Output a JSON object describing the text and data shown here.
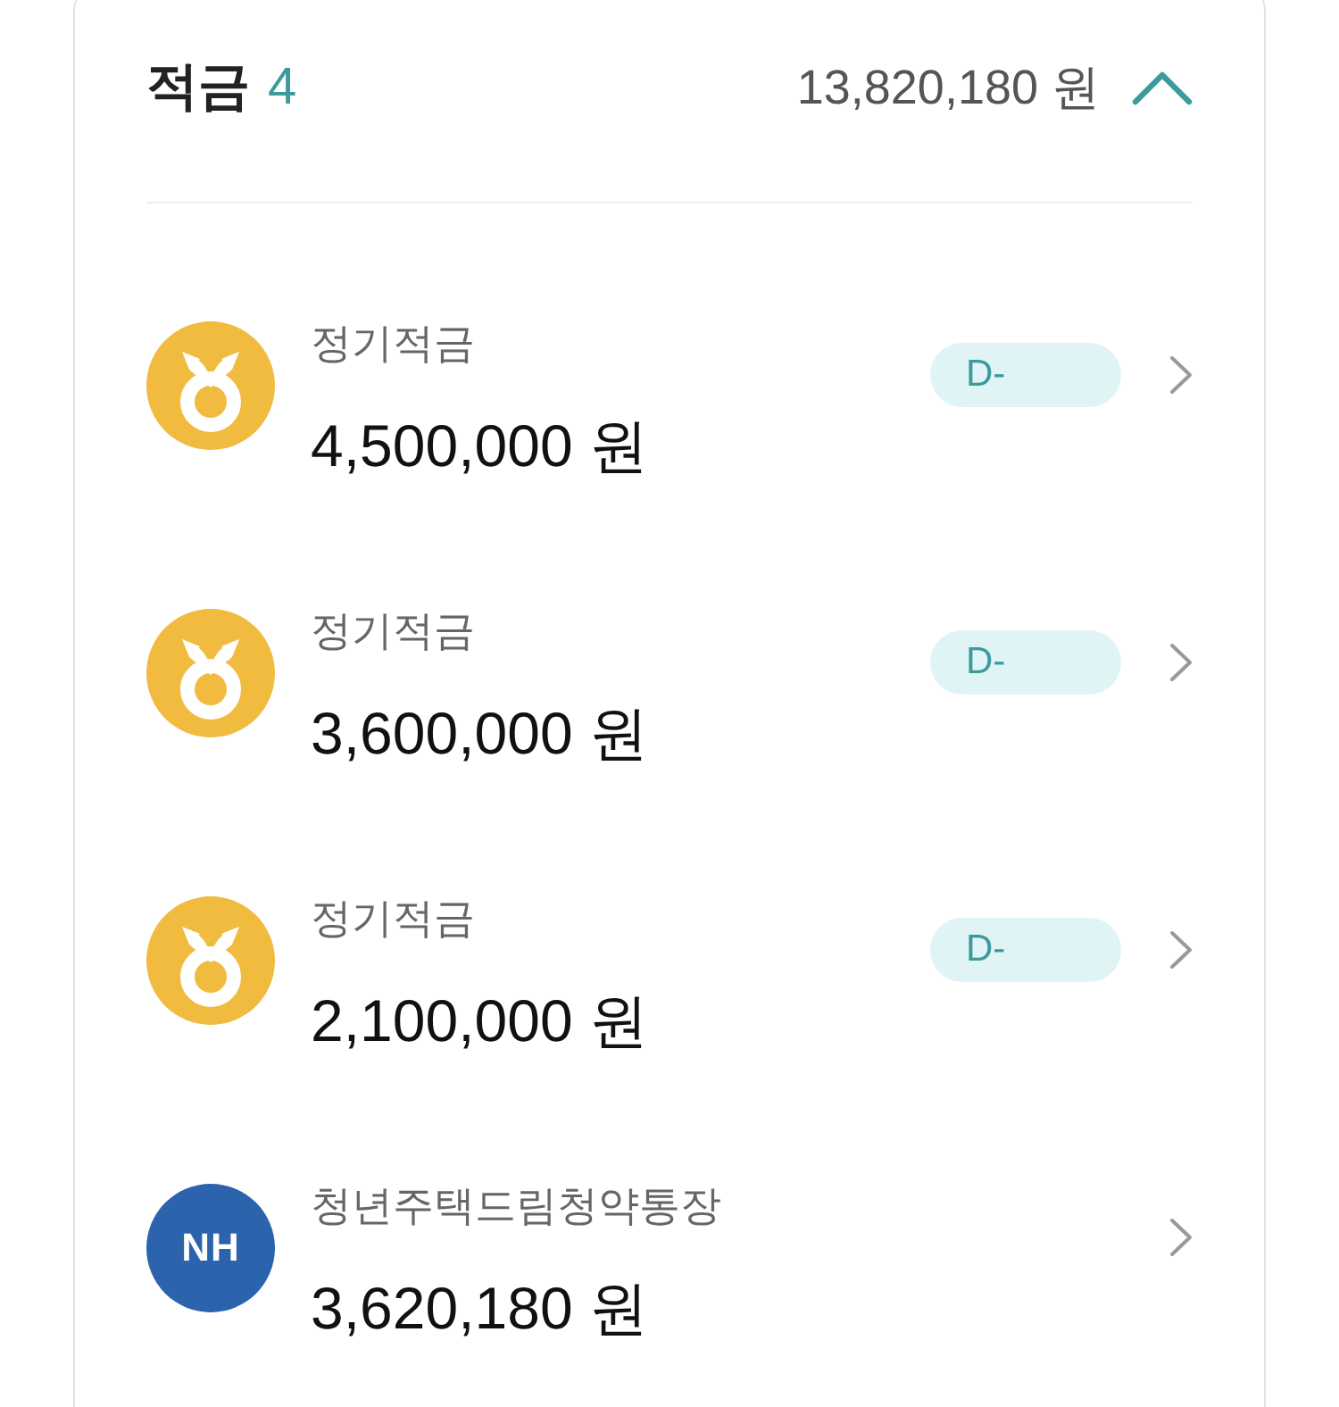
{
  "section": {
    "title": "적금",
    "count": "4",
    "total": "13,820,180 원",
    "expanded": true
  },
  "accounts": [
    {
      "logo": {
        "kind": "medal"
      },
      "name": "정기적금",
      "amount": "4,500,000 원",
      "badge": "D-"
    },
    {
      "logo": {
        "kind": "medal"
      },
      "name": "정기적금",
      "amount": "3,600,000 원",
      "badge": "D-"
    },
    {
      "logo": {
        "kind": "medal"
      },
      "name": "정기적금",
      "amount": "2,100,000 원",
      "badge": "D-"
    },
    {
      "logo": {
        "kind": "text",
        "text": "NH"
      },
      "name": "청년주택드림청약통장",
      "amount": "3,620,180 원"
    }
  ]
}
